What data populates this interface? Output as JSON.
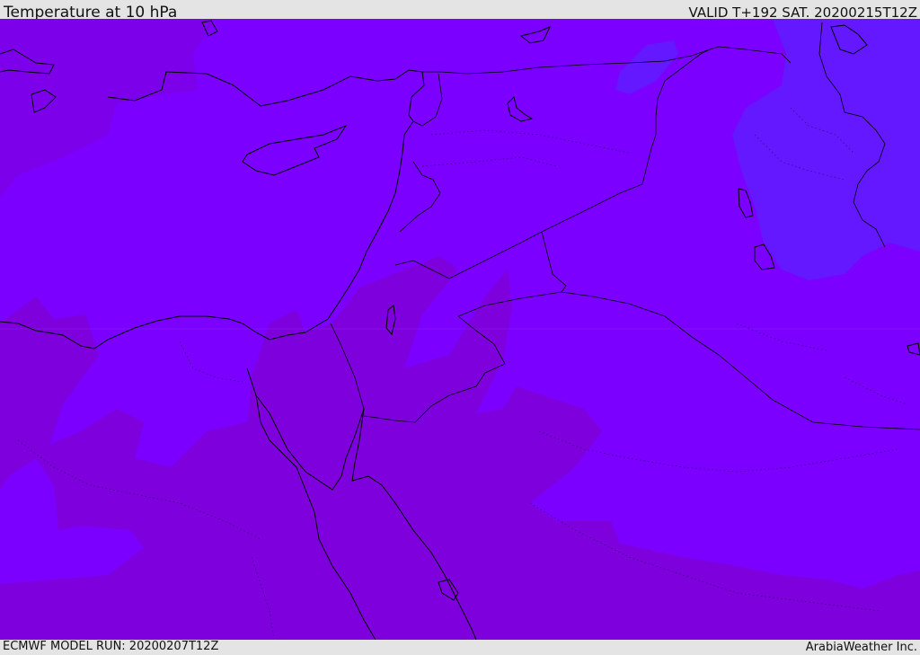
{
  "header": {
    "title": "Temperature at 10 hPa",
    "valid": "VALID T+192 SAT. 20200215T12Z"
  },
  "footer": {
    "model_run": "ECMWF MODEL RUN: 20200207T12Z",
    "credit": "ArabiaWeather Inc."
  },
  "map": {
    "base_color": "#7b00ff",
    "warm_color": "#7e00dd",
    "warmer_color": "#7d00ea",
    "cold_color": "#6318ff",
    "coast_color": "#000000"
  }
}
